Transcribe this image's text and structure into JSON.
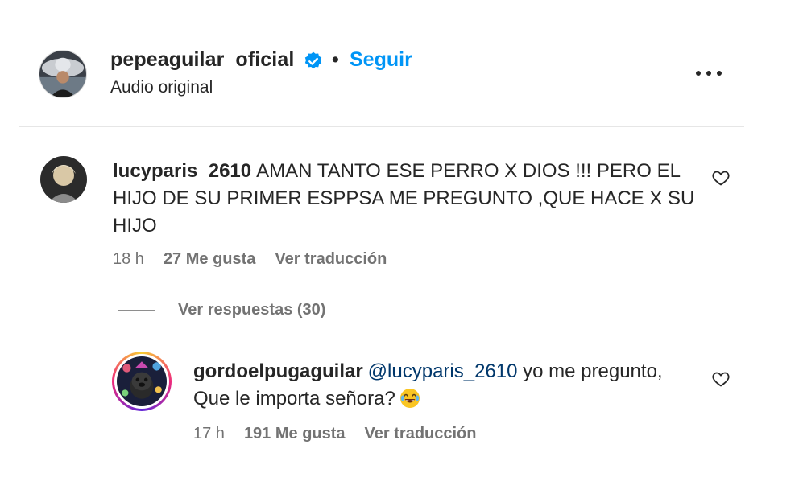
{
  "header": {
    "username": "pepeaguilar_oficial",
    "separator": "•",
    "follow_label": "Seguir",
    "subtitle": "Audio original",
    "verified_icon": "verified-badge-icon",
    "more_icon": "more-options-icon"
  },
  "comments": [
    {
      "username": "lucyparis_2610",
      "text": "AMAN TANTO ESE PERRO X DIOS !!! PERO EL HIJO DE SU PRIMER ESPPSA ME PREGUNTO ,QUE HACE X SU HIJO",
      "time": "18 h",
      "likes": "27 Me gusta",
      "translate": "Ver traducción"
    }
  ],
  "replies_toggle": "Ver respuestas (30)",
  "reply": {
    "username": "gordoelpugaguilar",
    "mention": "@lucyparis_2610",
    "text": " yo me pregunto, Que le importa señora?",
    "time": "17 h",
    "likes": "191 Me gusta",
    "translate": "Ver traducción",
    "emoji": "face-with-tears-of-joy"
  },
  "colors": {
    "accent": "#0095f6",
    "mention": "#00376b",
    "muted": "#737373",
    "text": "#262626"
  }
}
